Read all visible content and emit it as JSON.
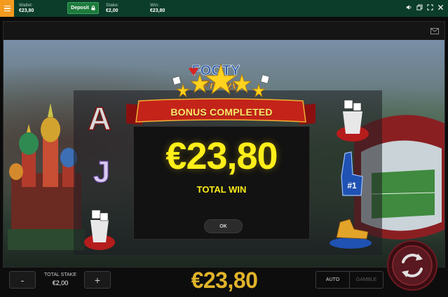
{
  "topbar": {
    "wallet_label": "Wallet:",
    "wallet_value": "€23,80",
    "deposit_label": "Deposit",
    "stake_label": "Stake:",
    "stake_value": "€2,00",
    "win_label": "Win:",
    "win_value": "€23,80"
  },
  "game": {
    "logo_line1": "FOOTY",
    "logo_line2": "Frenzy",
    "reel_symbols": [
      "A",
      "J"
    ]
  },
  "bonus": {
    "banner_title": "BONUS COMPLETED",
    "amount": "€23,80",
    "amount_label": "TOTAL WIN",
    "ok_label": "OK"
  },
  "controls": {
    "minus_label": "-",
    "plus_label": "+",
    "stake_title": "TOTAL STAKE",
    "stake_value": "€2,00",
    "total_win_display": "€23,80",
    "auto_label": "AUTO",
    "gamble_label": "GAMBLE"
  },
  "colors": {
    "topbar_bg": "#0b3d2a",
    "menu_accent": "#f39a1f",
    "deposit_green": "#1d7a3c",
    "win_yellow": "#ffee1a",
    "bottom_win_gold": "#e0b32a",
    "ribbon_red": "#c4231a"
  }
}
